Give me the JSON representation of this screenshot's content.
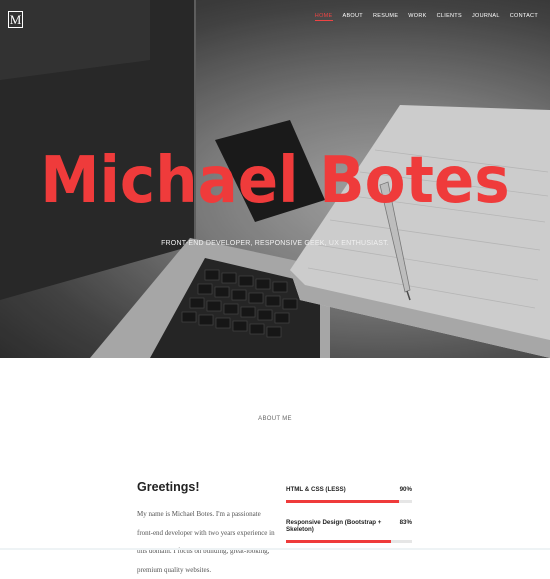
{
  "brand": {
    "logo_letter": "M"
  },
  "nav": {
    "items": [
      {
        "label": "HOME",
        "active": true
      },
      {
        "label": "ABOUT",
        "active": false
      },
      {
        "label": "RESUME",
        "active": false
      },
      {
        "label": "WORK",
        "active": false
      },
      {
        "label": "CLIENTS",
        "active": false
      },
      {
        "label": "JOURNAL",
        "active": false
      },
      {
        "label": "CONTACT",
        "active": false
      }
    ]
  },
  "hero": {
    "title": "Michael Botes",
    "subtitle": "FRONT-END DEVELOPER, RESPONSIVE GEEK, UX ENTHUSIAST."
  },
  "about": {
    "heading": "ABOUT ME",
    "greeting": "Greetings!",
    "bio": "My name is Michael Botes. I'm a passionate front-end developer with two years experience in this domain. I focus on building, great-looking, premium quality websites."
  },
  "skills": [
    {
      "name": "HTML & CSS (LESS)",
      "percent_label": "90%",
      "level": 0.9
    },
    {
      "name": "Responsive Design (Bootstrap + Skeleton)",
      "percent_label": "83%",
      "level": 0.83
    }
  ],
  "colors": {
    "accent": "#ef3b3b",
    "text": "#222222",
    "muted": "#555555"
  }
}
